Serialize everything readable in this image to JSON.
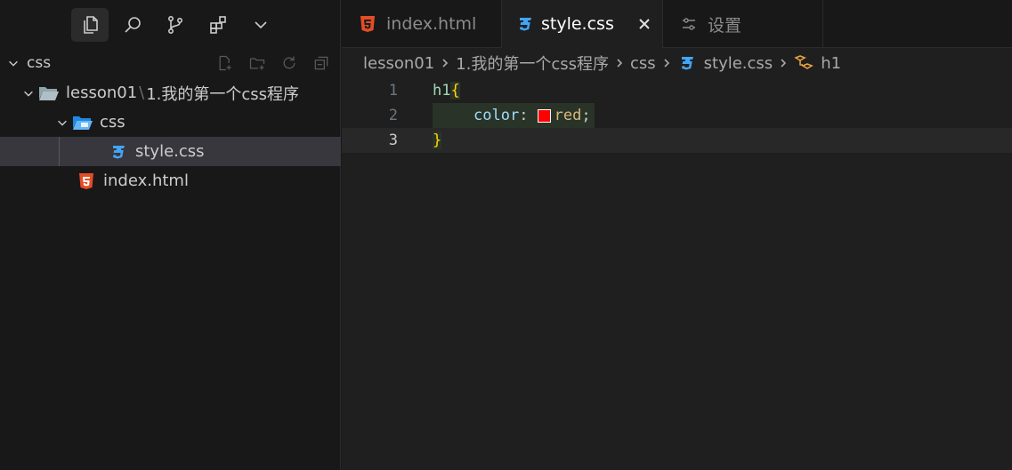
{
  "activity_bar": {
    "items": [
      "explorer-icon",
      "search-icon",
      "source-control-icon",
      "extensions-icon",
      "chevron-down-icon"
    ]
  },
  "explorer": {
    "section_title": "css",
    "tree": [
      {
        "label": "lesson01",
        "suffix": "1.我的第一个css程序",
        "separator": "\\",
        "type": "folder-open"
      },
      {
        "label": "css",
        "type": "css-folder"
      },
      {
        "label": "style.css",
        "type": "css-file",
        "selected": true
      },
      {
        "label": "index.html",
        "type": "html-file"
      }
    ]
  },
  "tabs": [
    {
      "label": "index.html",
      "icon": "html5-icon",
      "active": false
    },
    {
      "label": "style.css",
      "icon": "css3-icon",
      "active": true
    },
    {
      "label": "设置",
      "icon": "settings-icon",
      "active": false
    }
  ],
  "breadcrumb": [
    "lesson01",
    "1.我的第一个css程序",
    "css",
    "style.css",
    "h1"
  ],
  "code": {
    "lines": [
      {
        "number": "1",
        "selector": "h1",
        "brace": "{"
      },
      {
        "number": "2",
        "property": "color",
        "colon": ": ",
        "value": "red",
        "semi": ";"
      },
      {
        "number": "3",
        "brace": "}"
      }
    ],
    "swatch_color": "#ff0000"
  },
  "colors": {
    "html_icon": "#e44d26",
    "css_icon": "#42a5f5",
    "folder_icon": "#90a4ae"
  }
}
